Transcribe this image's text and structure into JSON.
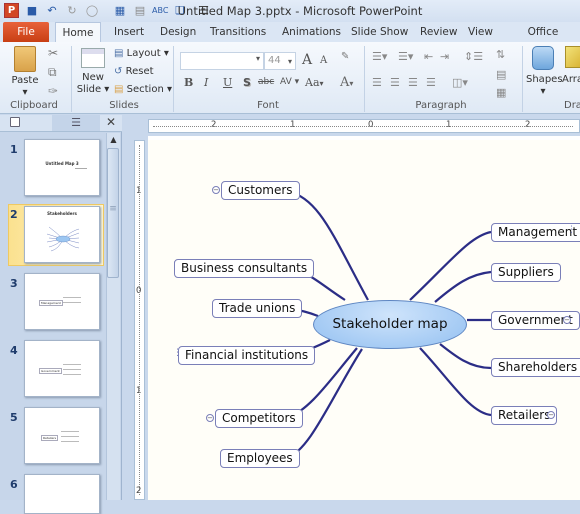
{
  "window": {
    "title": "Untitled Map 3.pptx  -  Microsoft PowerPoint",
    "app_icon": "P"
  },
  "quick_access": [
    "save-icon",
    "undo-icon",
    "redo-icon",
    "repeat-icon",
    "screenshot-icon",
    "table-icon",
    "spelling-icon",
    "paste-special-icon",
    "customize-icon"
  ],
  "tabs": [
    "File",
    "Home",
    "Insert",
    "Design",
    "Transitions",
    "Animations",
    "Slide Show",
    "Review",
    "View",
    "Office Timeline"
  ],
  "ribbon": {
    "clipboard": {
      "paste": "Paste",
      "label": "Clipboard"
    },
    "slides": {
      "new_slide": "New Slide",
      "layout": "Layout",
      "reset": "Reset",
      "section": "Section",
      "label": "Slides"
    },
    "font": {
      "font_name": "",
      "font_size": "44",
      "bold": "B",
      "italic": "I",
      "underline": "U",
      "shadow": "S",
      "strike": "abc",
      "spacing": "AV",
      "case": "Aa",
      "color": "A",
      "grow": "A",
      "shrink": "A",
      "label": "Font"
    },
    "paragraph": {
      "label": "Paragraph"
    },
    "drawing": {
      "shapes": "Shapes",
      "arrange": "Arra",
      "label": "Dra"
    }
  },
  "slides_pane": {
    "slides": [
      {
        "number": "1",
        "title": "Untitled Map 3"
      },
      {
        "number": "2",
        "title": "Stakeholders",
        "selected": true
      },
      {
        "number": "3",
        "title": "Management"
      },
      {
        "number": "4",
        "title": "Government"
      },
      {
        "number": "5",
        "title": "Retailers"
      },
      {
        "number": "6",
        "title": ""
      }
    ]
  },
  "rulers": {
    "horizontal": [
      "2",
      "1",
      "0",
      "1",
      "2"
    ],
    "vertical": [
      "1",
      "0",
      "1",
      "2"
    ]
  },
  "mindmap": {
    "center": "Stakeholder map",
    "left": [
      "Customers",
      "Business consultants",
      "Trade unions",
      "Financial institutions",
      "Competitors",
      "Employees"
    ],
    "right": [
      "Management",
      "Suppliers",
      "Government",
      "Shareholders",
      "Retailers"
    ]
  },
  "colors": {
    "file_tab": "#d24726",
    "connector": "#2b2d86",
    "center_fill": "#a9cdf4",
    "selected_slide": "#fbe18f"
  }
}
